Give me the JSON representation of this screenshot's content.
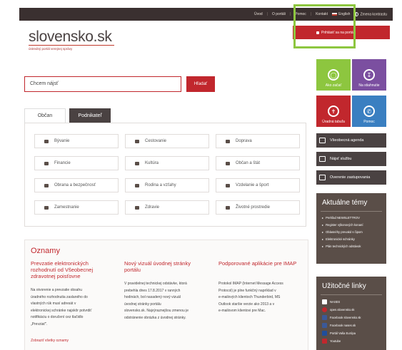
{
  "topnav": [
    "Úvod",
    "O portáli",
    "Pomoc",
    "Kontakt",
    "English",
    "Zmena kontrastu"
  ],
  "logo": {
    "title": "slovensko.sk",
    "subtitle": "ústredný portál verejnej správy"
  },
  "login": "Prihlásiť sa na portál",
  "search": {
    "placeholder": "Chcem nájsť",
    "button": "Hľadať"
  },
  "tiles": [
    {
      "label": "Ako začať",
      "color": "#8dc63f",
      "icon": "lightbulb-icon"
    },
    {
      "label": "Na stiahnutie",
      "color": "#7b4fa0",
      "icon": "download-icon"
    },
    {
      "label": "Úradná tabuľa",
      "color": "#c1272d",
      "icon": "pin-icon"
    },
    {
      "label": "Pomoc",
      "color": "#3a7fc1",
      "icon": "phone-icon"
    }
  ],
  "sidebuttons": [
    "Všeobecná agenda",
    "Nájsť službu",
    "Overenie zastupovania"
  ],
  "tabs": {
    "active": "Občan",
    "inactive": "Podnikateľ"
  },
  "categories": [
    "Bývanie",
    "Cestovanie",
    "Doprava",
    "Financie",
    "Kultúra",
    "Občan a štát",
    "Obrana a bezpečnosť",
    "Rodina a vzťahy",
    "Vzdelanie a šport",
    "Zamestnanie",
    "Zdravie",
    "Životné prostredie"
  ],
  "aktualne": {
    "title": "Aktuálne témy",
    "items": [
      "Prehľad NEWSLETTROV",
      "Register výkonových konaní",
      "Oblasnéhy prevakd s čipom",
      "Elektronické schránky",
      "Plán technických odstávok"
    ]
  },
  "uzitocne": {
    "title": "Užitočné linky",
    "items": [
      {
        "label": "NASES",
        "color": "#ffffff"
      },
      {
        "label": "open.slovensko.sk",
        "color": "#c1272d"
      },
      {
        "label": "Facebook slovensko.sk",
        "color": "#3b5998"
      },
      {
        "label": "Facebook nases.sk",
        "color": "#3b5998"
      },
      {
        "label": "Portál Vaša Európa",
        "color": "#1f4e9c"
      },
      {
        "label": "Youtube",
        "color": "#c1272d"
      }
    ]
  },
  "oznamy": {
    "title": "Oznamy",
    "col1": {
      "title": "Prevzatie elektronických rozhodnutí od Všeobecnej zdravotnej poisťovne",
      "text": [
        "Na otvorenie a prevzatie obsahu",
        "úradného rozhodnutia zaslaného do",
        "vlastných rúk musí adresát v",
        "elektronickej schránke najskôr potvrdiť",
        "notifikáciu o doručení cez tlačidlo",
        "„Prevziať\"."
      ]
    },
    "col2": {
      "title": "Nový vizuál úvodnej stránky portálu",
      "text": [
        "V pravidelnej technickej odstávke, ktorá",
        "prebehla dnes 17.8.2017 v ranných",
        "hodinách, bol nasadený nový vizuál",
        "úvodnej stránky portálu",
        "slovensko.sk. Najvýraznejšou zmenou je",
        "odstránenie obrázka z úvodnej stránky."
      ]
    },
    "col3": {
      "title": "Podporované aplikácie pre IMAP",
      "text": [
        "Protokol IMAP (Internet Message Access",
        "Protocol) je plne funkčný napríklad v",
        "e-mailových klientoch Thunderbird, MS",
        "Outlook staršie verzie ako 2013 a v",
        "e-mailovom klientovi pre Mac."
      ]
    },
    "more": "Zobraziť všetky oznamy"
  }
}
